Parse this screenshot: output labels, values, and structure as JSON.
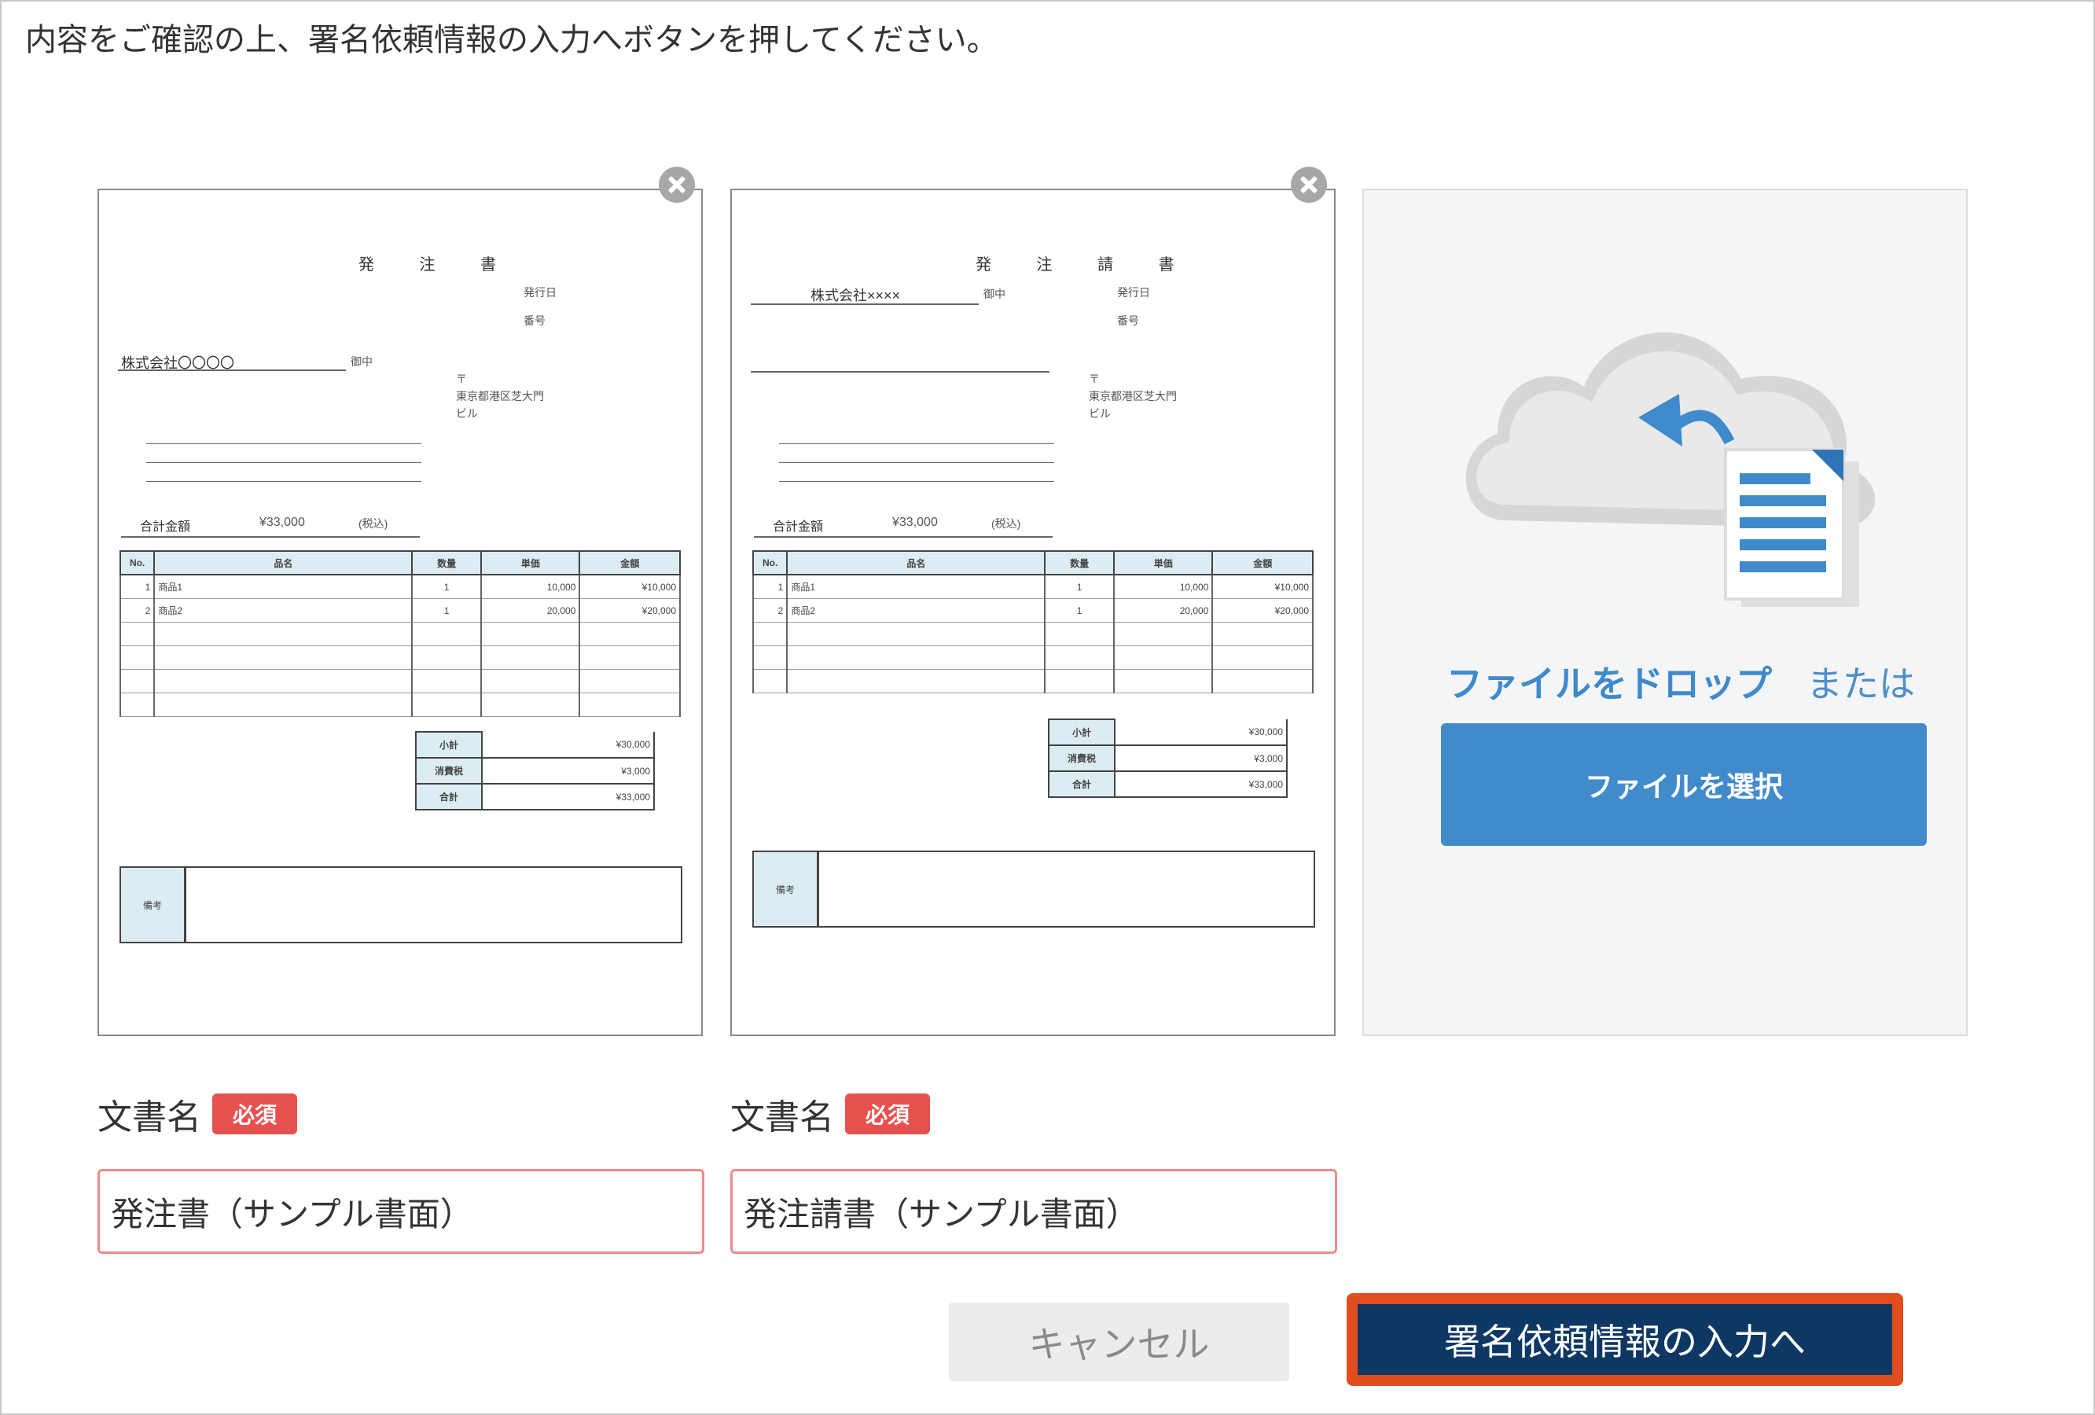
{
  "instruction": "内容をご確認の上、署名依頼情報の入力へボタンを押してください。",
  "documents": [
    {
      "preview_title": "発 注 書",
      "company": "株式会社〇〇〇〇",
      "honorific": "御中",
      "total_label": "合計金額",
      "total_value": "¥33,000",
      "tax_note": "(税込)",
      "columns": [
        "No.",
        "品名",
        "数量",
        "単価",
        "金額"
      ],
      "rows": [
        [
          "1",
          "商品1",
          "1",
          "10,000",
          "¥10,000"
        ],
        [
          "2",
          "商品2",
          "1",
          "20,000",
          "¥20,000"
        ]
      ],
      "summary": [
        [
          "小計",
          "¥30,000"
        ],
        [
          "消費税",
          "¥3,000"
        ],
        [
          "合計",
          "¥33,000"
        ]
      ],
      "note_label": "備考",
      "name_label": "文書名",
      "required_badge": "必須",
      "name_value": "発注書（サンプル書面）"
    },
    {
      "preview_title": "発 注 請 書",
      "company": "株式会社××××",
      "honorific": "御中",
      "total_label": "合計金額",
      "total_value": "¥33,000",
      "tax_note": "(税込)",
      "columns": [
        "No.",
        "品名",
        "数量",
        "単価",
        "金額"
      ],
      "rows": [
        [
          "1",
          "商品1",
          "1",
          "10,000",
          "¥10,000"
        ],
        [
          "2",
          "商品2",
          "1",
          "20,000",
          "¥20,000"
        ]
      ],
      "summary": [
        [
          "小計",
          "¥30,000"
        ],
        [
          "消費税",
          "¥3,000"
        ],
        [
          "合計",
          "¥33,000"
        ]
      ],
      "note_label": "備考",
      "name_label": "文書名",
      "required_badge": "必須",
      "name_value": "発注請書（サンプル書面）"
    }
  ],
  "upload": {
    "drop_text": "ファイルをドロップ",
    "or_text": "または",
    "select_button": "ファイルを選択",
    "icon": "cloud-upload-icon"
  },
  "actions": {
    "cancel": "キャンセル",
    "next": "署名依頼情報の入力へ"
  },
  "colors": {
    "required": "#e65150",
    "select_button": "#428bcb",
    "next_button": "#0e3863",
    "next_highlight": "#e04d1e",
    "table_header": "#dcecf3"
  }
}
